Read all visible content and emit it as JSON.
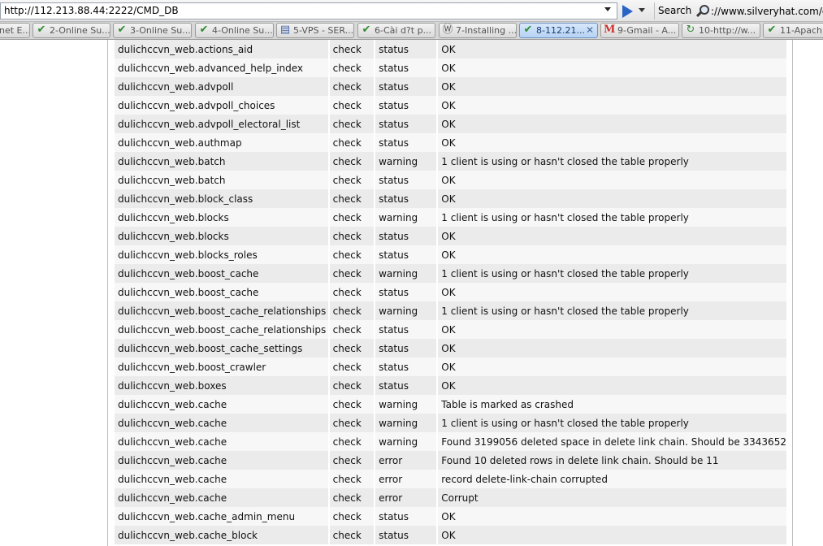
{
  "browser": {
    "url": "http://112.213.88.44:2222/CMD_DB",
    "search_label": "Search",
    "search_value": "://www.silveryhat.com/de",
    "tabs": [
      {
        "label": "net E...",
        "icon": "check-icon"
      },
      {
        "label": "2-Online Su...",
        "icon": "check-icon"
      },
      {
        "label": "3-Online Su...",
        "icon": "check-icon"
      },
      {
        "label": "4-Online Su...",
        "icon": "check-icon"
      },
      {
        "label": "5-VPS - SER...",
        "icon": "document-icon"
      },
      {
        "label": "6-Cài d?t p...",
        "icon": "check-icon"
      },
      {
        "label": "7-Installing ...",
        "icon": "wordpress-icon"
      },
      {
        "label": "8-112.21...",
        "icon": "check-icon",
        "active": true
      },
      {
        "label": "9-Gmail - A...",
        "icon": "gmail-icon"
      },
      {
        "label": "10-http://w...",
        "icon": "loading-icon"
      },
      {
        "label": "11-Apach",
        "icon": "check-icon"
      }
    ]
  },
  "results": [
    {
      "table": "dulichccvn_web.actions_aid",
      "op": "check",
      "type": "status",
      "text": "OK"
    },
    {
      "table": "dulichccvn_web.advanced_help_index",
      "op": "check",
      "type": "status",
      "text": "OK"
    },
    {
      "table": "dulichccvn_web.advpoll",
      "op": "check",
      "type": "status",
      "text": "OK"
    },
    {
      "table": "dulichccvn_web.advpoll_choices",
      "op": "check",
      "type": "status",
      "text": "OK"
    },
    {
      "table": "dulichccvn_web.advpoll_electoral_list",
      "op": "check",
      "type": "status",
      "text": "OK"
    },
    {
      "table": "dulichccvn_web.authmap",
      "op": "check",
      "type": "status",
      "text": "OK"
    },
    {
      "table": "dulichccvn_web.batch",
      "op": "check",
      "type": "warning",
      "text": "1 client is using or hasn't closed the table properly"
    },
    {
      "table": "dulichccvn_web.batch",
      "op": "check",
      "type": "status",
      "text": "OK"
    },
    {
      "table": "dulichccvn_web.block_class",
      "op": "check",
      "type": "status",
      "text": "OK"
    },
    {
      "table": "dulichccvn_web.blocks",
      "op": "check",
      "type": "warning",
      "text": "1 client is using or hasn't closed the table properly"
    },
    {
      "table": "dulichccvn_web.blocks",
      "op": "check",
      "type": "status",
      "text": "OK"
    },
    {
      "table": "dulichccvn_web.blocks_roles",
      "op": "check",
      "type": "status",
      "text": "OK"
    },
    {
      "table": "dulichccvn_web.boost_cache",
      "op": "check",
      "type": "warning",
      "text": "1 client is using or hasn't closed the table properly"
    },
    {
      "table": "dulichccvn_web.boost_cache",
      "op": "check",
      "type": "status",
      "text": "OK"
    },
    {
      "table": "dulichccvn_web.boost_cache_relationships",
      "op": "check",
      "type": "warning",
      "text": "1 client is using or hasn't closed the table properly"
    },
    {
      "table": "dulichccvn_web.boost_cache_relationships",
      "op": "check",
      "type": "status",
      "text": "OK"
    },
    {
      "table": "dulichccvn_web.boost_cache_settings",
      "op": "check",
      "type": "status",
      "text": "OK"
    },
    {
      "table": "dulichccvn_web.boost_crawler",
      "op": "check",
      "type": "status",
      "text": "OK"
    },
    {
      "table": "dulichccvn_web.boxes",
      "op": "check",
      "type": "status",
      "text": "OK"
    },
    {
      "table": "dulichccvn_web.cache",
      "op": "check",
      "type": "warning",
      "text": "Table is marked as crashed"
    },
    {
      "table": "dulichccvn_web.cache",
      "op": "check",
      "type": "warning",
      "text": "1 client is using or hasn't closed the table properly"
    },
    {
      "table": "dulichccvn_web.cache",
      "op": "check",
      "type": "warning",
      "text": "Found 3199056 deleted space in delete link chain. Should be 3343652"
    },
    {
      "table": "dulichccvn_web.cache",
      "op": "check",
      "type": "error",
      "text": "Found 10 deleted rows in delete link chain. Should be 11"
    },
    {
      "table": "dulichccvn_web.cache",
      "op": "check",
      "type": "error",
      "text": "record delete-link-chain corrupted"
    },
    {
      "table": "dulichccvn_web.cache",
      "op": "check",
      "type": "error",
      "text": "Corrupt"
    },
    {
      "table": "dulichccvn_web.cache_admin_menu",
      "op": "check",
      "type": "status",
      "text": "OK"
    },
    {
      "table": "dulichccvn_web.cache_block",
      "op": "check",
      "type": "status",
      "text": "OK"
    }
  ]
}
